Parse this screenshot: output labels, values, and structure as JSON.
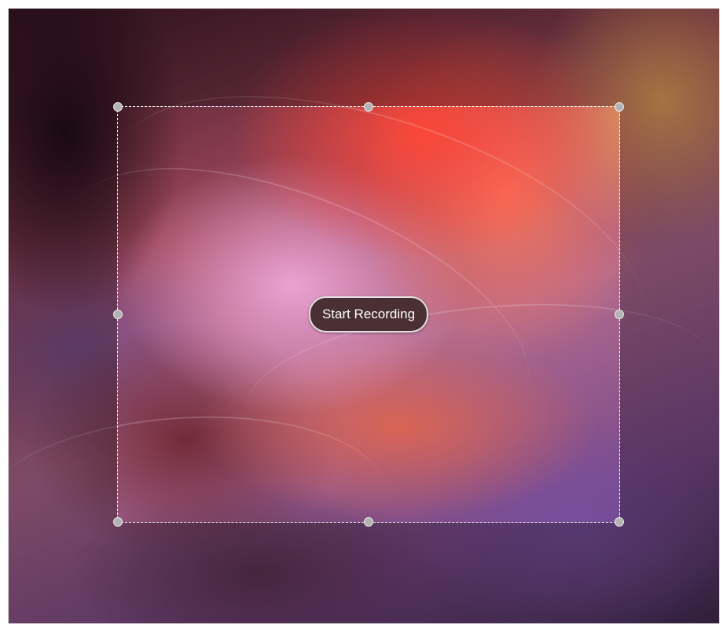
{
  "window": {
    "title": ""
  },
  "selection": {
    "start_label": "Start Recording"
  },
  "colors": {
    "button_bg": "#4a2f34",
    "button_text": "#ffffff",
    "handle_fill": "#b3b3b3",
    "selection_border": "#ffffff"
  }
}
